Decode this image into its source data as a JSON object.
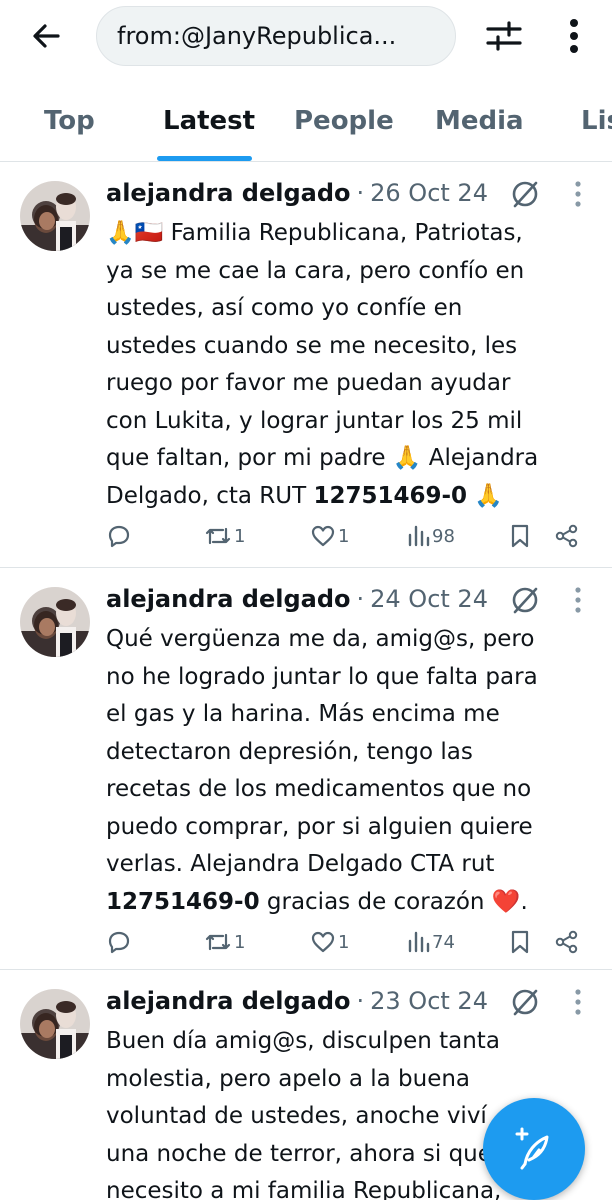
{
  "search": {
    "query": "from:@JanyRepublica..."
  },
  "tabs": [
    {
      "label": "Top"
    },
    {
      "label": "Latest"
    },
    {
      "label": "People"
    },
    {
      "label": "Media"
    },
    {
      "label": "Lis"
    }
  ],
  "active_tab": "Latest",
  "accent_color": "#1d9bf0",
  "tweets": [
    {
      "author": "alejandra delgado",
      "separator": "·",
      "date": "26 Oct 24",
      "text_lines": [
        "🙏🇨🇱 Familia Republicana, Patriotas,",
        "ya se me cae la cara, pero confío en",
        "ustedes, así como yo confíe en",
        "ustedes cuando se me necesito, les",
        "ruego por favor me puedan ayudar",
        "con Lukita, y lograr juntar los 25 mil",
        "que faltan, por mi padre 🙏 Alejandra"
      ],
      "last_line_prefix": "Delgado, cta RUT ",
      "last_line_bold": "12751469-0",
      "last_line_suffix": " 🙏",
      "replies": "",
      "reposts": "1",
      "likes": "1",
      "views": "98"
    },
    {
      "author": "alejandra delgado",
      "separator": "·",
      "date": "24 Oct 24",
      "text_lines": [
        "Qué vergüenza me da, amig@s, pero",
        "no he logrado juntar lo que falta para",
        "el gas y la harina. Más encima me",
        "detectaron depresión, tengo las",
        "recetas de los medicamentos que no",
        "puedo comprar, por si alguien quiere",
        "verlas.  Alejandra Delgado CTA rut"
      ],
      "last_line_prefix": "",
      "last_line_bold": "12751469-0",
      "last_line_suffix": " gracias de corazón ❤️.",
      "replies": "",
      "reposts": "1",
      "likes": "1",
      "views": "74"
    },
    {
      "author": "alejandra delgado",
      "separator": "·",
      "date": "23 Oct 24",
      "text_lines": [
        "Buen día amig@s, disculpen tanta",
        "molestia, pero apelo a la buena",
        "voluntad de ustedes, anoche viví",
        "una noche de terror, ahora si que",
        "necesito a mi familia Republicana,"
      ]
    }
  ],
  "icons": {
    "back": "arrow-left-icon",
    "filter": "sliders-icon",
    "more": "vertical-dots-icon",
    "reply": "speech-bubble-icon",
    "repost": "repost-arrows-icon",
    "like": "heart-icon",
    "views": "bar-chart-icon",
    "bookmark": "bookmark-icon",
    "share": "share-nodes-icon",
    "compose": "feather-plus-icon",
    "restricted": "no-sign-icon"
  }
}
